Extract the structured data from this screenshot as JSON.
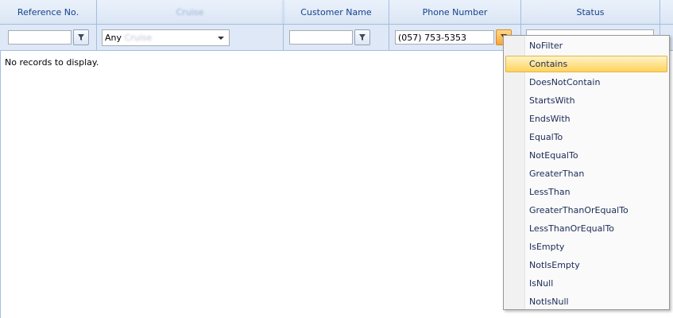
{
  "grid": {
    "headers": {
      "reference_no": "Reference No.",
      "cruise": "Cruise",
      "customer_name": "Customer Name",
      "phone_number": "Phone Number",
      "status": "Status"
    },
    "filters": {
      "reference_value": "",
      "cruise_selected_prefix": "Any",
      "cruise_selected_rest": "Cruise",
      "customer_value": "",
      "phone_value": "(057) 753-5353"
    },
    "empty_message": "No records to display."
  },
  "filter_menu": {
    "items": [
      {
        "label": "NoFilter"
      },
      {
        "label": "Contains",
        "highlighted": true
      },
      {
        "label": "DoesNotContain"
      },
      {
        "label": "StartsWith"
      },
      {
        "label": "EndsWith"
      },
      {
        "label": "EqualTo"
      },
      {
        "label": "NotEqualTo"
      },
      {
        "label": "GreaterThan"
      },
      {
        "label": "LessThan"
      },
      {
        "label": "GreaterThanOrEqualTo"
      },
      {
        "label": "LessThanOrEqualTo"
      },
      {
        "label": "IsEmpty"
      },
      {
        "label": "NotIsEmpty"
      },
      {
        "label": "IsNull"
      },
      {
        "label": "NotIsNull"
      }
    ]
  },
  "colors": {
    "header_text": "#15428b",
    "border": "#a3bde0",
    "filter_row_bg": "#dfe8f6",
    "highlight": "#ffd35d",
    "active_filter_button": "#f6a53c"
  }
}
